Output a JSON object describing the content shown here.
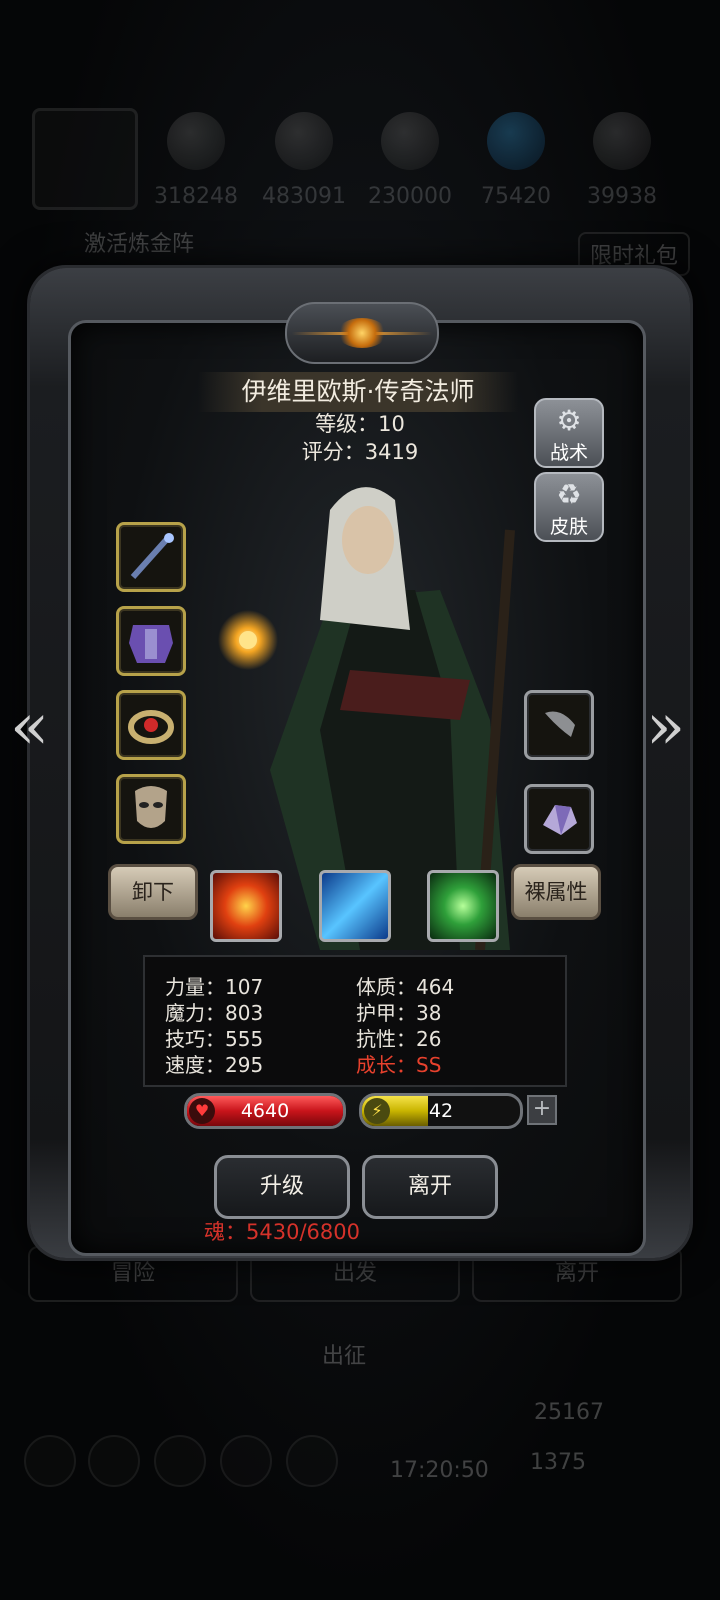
{
  "background": {
    "resources": [
      "318248",
      "483091",
      "230000",
      "75420",
      "39938"
    ],
    "activate_label": "激活炼金阵",
    "promo_label": "限时礼包",
    "bottom_buttons": [
      "冒险",
      "出发",
      "离开"
    ],
    "expedition_label": "出征",
    "gold_value": "25167",
    "gem_value": "1375",
    "clock": "17:20:50"
  },
  "hero": {
    "name": "伊维里欧斯·传奇法师",
    "level_label": "等级：10",
    "score_label": "评分：3419"
  },
  "side_buttons": {
    "tactics": "战术",
    "skin": "皮肤"
  },
  "equipment": {
    "left": [
      "staff",
      "armor",
      "ring",
      "mask"
    ],
    "right": [
      "claw",
      "crystal"
    ]
  },
  "actions": {
    "unequip": "卸下",
    "naked_attr": "裸属性",
    "upgrade": "升级",
    "leave": "离开"
  },
  "skills": [
    "fire-burst",
    "ice-shards",
    "nature-leaf"
  ],
  "stats": {
    "strength": "力量：107",
    "magic": "魔力：803",
    "skill": "技巧：555",
    "speed": "速度：295",
    "constitution": "体质：464",
    "armor": "护甲：38",
    "resistance": "抗性：26",
    "growth": "成长：SS"
  },
  "bars": {
    "hp": "4640",
    "hp_fill": 1.0,
    "energy": "42",
    "energy_fill": 0.42
  },
  "soul_label": "魂：5430/6800",
  "colors": {
    "hp": "#c8141b",
    "energy": "#c8b400",
    "growth": "#e7412d",
    "soul": "#d5322a"
  }
}
